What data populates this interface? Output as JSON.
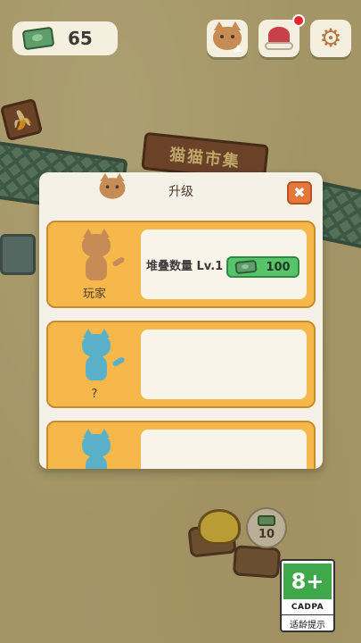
{
  "hud": {
    "money": "65"
  },
  "scene": {
    "market_sign": "猫猫市集",
    "stall_price": "10"
  },
  "modal": {
    "title": "升级",
    "close_label": "✖",
    "cards": [
      {
        "name": "玩家",
        "stat": "堆叠数量 Lv.1",
        "cost": "100",
        "unlocked": true
      },
      {
        "name": "?",
        "stat": "",
        "cost": "",
        "unlocked": false
      },
      {
        "name": "",
        "stat": "",
        "cost": "",
        "unlocked": false
      }
    ]
  },
  "rating": {
    "age": "8+",
    "org": "CADPA",
    "text": "适龄提示"
  },
  "colors": {
    "card_bg": "#f6b84a",
    "cost_button": "#57c46a",
    "close_button": "#e4773a",
    "notification": "#e2262c",
    "rating_green": "#3fa84a"
  },
  "icons": [
    "cash-icon",
    "cat-upgrade-icon",
    "santa-hat-icon",
    "gear-icon",
    "close-icon"
  ]
}
